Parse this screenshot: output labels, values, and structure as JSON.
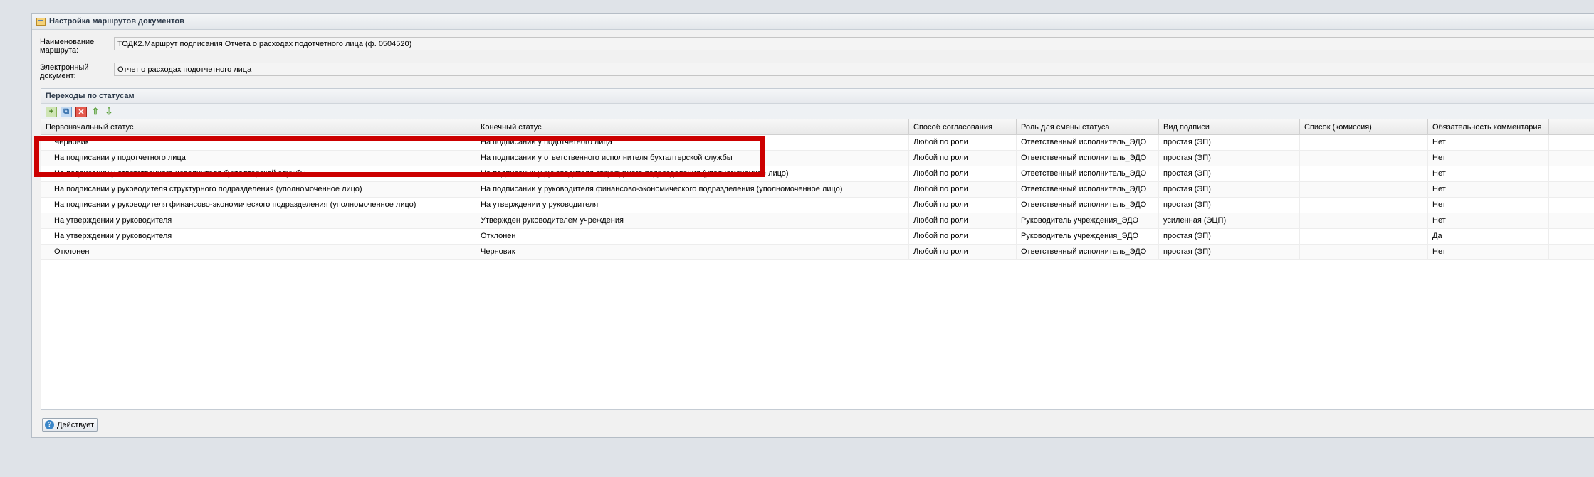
{
  "window": {
    "title": "Настройка маршрутов документов"
  },
  "form": {
    "route_name_label": "Наименование маршрута:",
    "route_name_value": "ТОДК2.Маршрут подписания Отчета о расходах подотчетного лица (ф. 0504520)",
    "doc_label": "Электронный документ:",
    "doc_value": "Отчет о расходах подотчетного лица"
  },
  "panel": {
    "title": "Переходы по статусам"
  },
  "toolbar": {
    "icons": [
      "add-icon",
      "copy-icon",
      "delete-icon",
      "move-up-icon",
      "move-down-icon"
    ],
    "add_glyph": "+",
    "copy_glyph": "⧉",
    "delete_glyph": "✕",
    "up_glyph": "⇧",
    "down_glyph": "⇩"
  },
  "grid": {
    "columns": [
      "Первоначальный статус",
      "Конечный статус",
      "Способ согласования",
      "Роль для смены статуса",
      "Вид подписи",
      "Список (комиссия)",
      "Обязательность комментария"
    ],
    "rows": [
      [
        "Черновик",
        "На подписании у подотчетного лица",
        "Любой по роли",
        "Ответственный исполнитель_ЭДО",
        "простая (ЭП)",
        "",
        "Нет"
      ],
      [
        "На подписании у подотчетного лица",
        "На подписании у ответственного исполнителя бухгалтерской службы",
        "Любой по роли",
        "Ответственный исполнитель_ЭДО",
        "простая (ЭП)",
        "",
        "Нет"
      ],
      [
        "На подписании у ответственного исполнителя бухгалтерской службы",
        "На подписании у руководителя структурного подразделения (уполномоченное лицо)",
        "Любой по роли",
        "Ответственный исполнитель_ЭДО",
        "простая (ЭП)",
        "",
        "Нет"
      ],
      [
        "На подписании у руководителя структурного подразделения (уполномоченное лицо)",
        "На подписании у руководителя финансово-экономического подразделения (уполномоченное лицо)",
        "Любой по роли",
        "Ответственный исполнитель_ЭДО",
        "простая (ЭП)",
        "",
        "Нет"
      ],
      [
        "На подписании у руководителя финансово-экономического подразделения (уполномоченное лицо)",
        "На утверждении у руководителя",
        "Любой по роли",
        "Ответственный исполнитель_ЭДО",
        "простая (ЭП)",
        "",
        "Нет"
      ],
      [
        "На утверждении у руководителя",
        "Утвержден руководителем учреждения",
        "Любой по роли",
        "Руководитель учреждения_ЭДО",
        "усиленная (ЭЦП)",
        "",
        "Нет"
      ],
      [
        "На утверждении у руководителя",
        "Отклонен",
        "Любой по роли",
        "Руководитель учреждения_ЭДО",
        "простая (ЭП)",
        "",
        "Да"
      ],
      [
        "Отклонен",
        "Черновик",
        "Любой по роли",
        "Ответственный исполнитель_ЭДО",
        "простая (ЭП)",
        "",
        "Нет"
      ]
    ]
  },
  "footer": {
    "status_button_label": "Действует",
    "status_icon": "help-icon"
  },
  "colors": {
    "highlight": "#cc0000",
    "accent": "#3a86c8"
  }
}
